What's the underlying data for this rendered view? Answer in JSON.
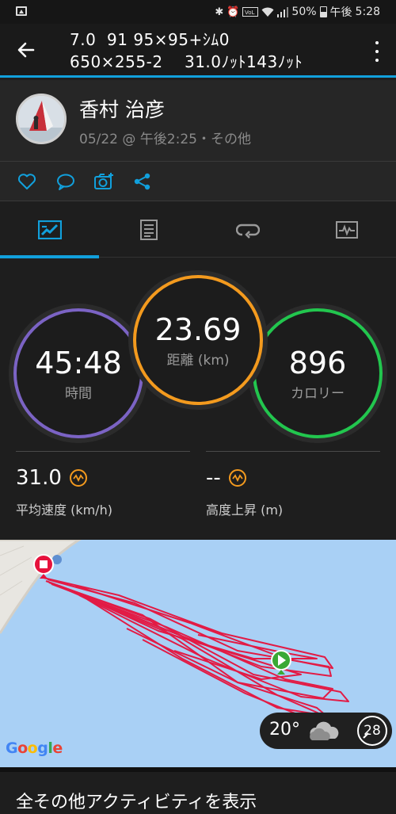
{
  "status_bar": {
    "battery_percent": "50%",
    "ampm": "午後",
    "time": "5:28",
    "icons": [
      "image-icon",
      "bluetooth-icon",
      "alarm-icon",
      "volte-icon",
      "wifi-icon",
      "signal-icon",
      "battery-icon"
    ]
  },
  "header": {
    "title_line1": "7.0  91 95×95+ｼﾑ0",
    "title_line2": "650×255-2    31.0ﾉｯﾄ143ﾉｯﾄ",
    "accent": "#11a0dc"
  },
  "profile": {
    "name": "香村 治彦",
    "subtitle": "05/22 @ 午後2:25・その他"
  },
  "actions": [
    "like-icon",
    "comment-icon",
    "add-photo-icon",
    "share-icon"
  ],
  "tabs": [
    "tab-summary",
    "tab-details",
    "tab-laps",
    "tab-charts"
  ],
  "stats": {
    "time": {
      "value": "45:48",
      "label": "時間",
      "color": "#7b63c4"
    },
    "distance": {
      "value": "23.69",
      "label": "距離 (km)",
      "color": "#f39a1e"
    },
    "calories": {
      "value": "896",
      "label": "カロリー",
      "color": "#22c64e"
    },
    "avg_speed": {
      "value": "31.0",
      "label": "平均速度 (km/h)"
    },
    "elevation_gain": {
      "value": "--",
      "label": "高度上昇 (m)"
    }
  },
  "map": {
    "brand": "Google",
    "temperature": "20°",
    "wind_speed": "28",
    "track_color": "#e6123c",
    "water_color": "#a9d0f5"
  },
  "footer": {
    "label": "全その他アクティビティを表示"
  }
}
